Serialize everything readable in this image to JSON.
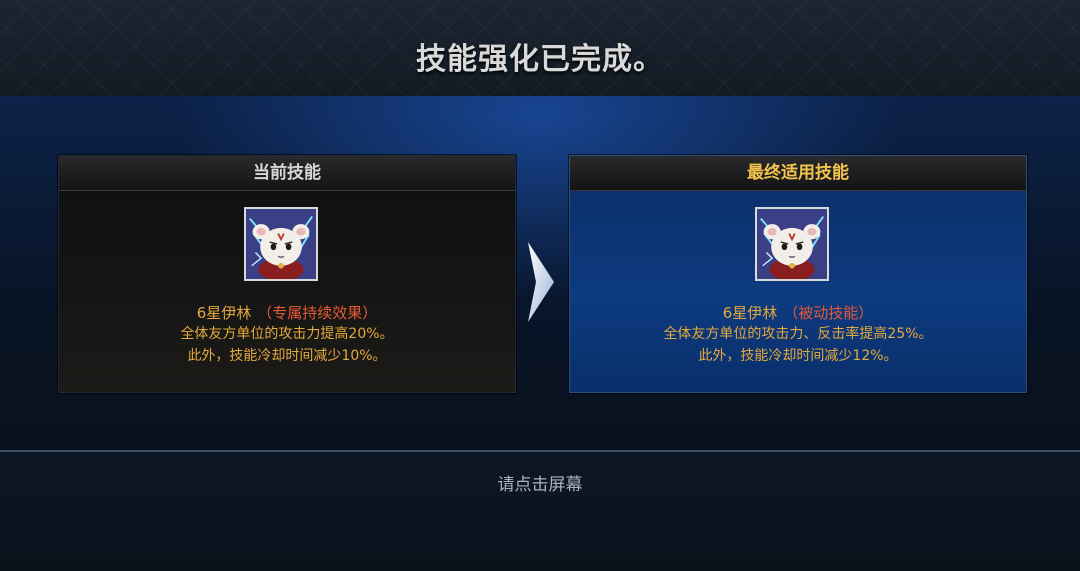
{
  "title": "技能强化已完成。",
  "current_panel": {
    "header": "当前技能",
    "skill_name": "6星伊林",
    "skill_tag": "（专属持续效果）",
    "desc_line1": "全体友方单位的攻击力提高20%。",
    "desc_line2": "此外，技能冷却时间减少10%。",
    "portrait_icon": "cat-hero-portrait-icon"
  },
  "final_panel": {
    "header": "最终适用技能",
    "skill_name": "6星伊林",
    "skill_tag": "（被动技能）",
    "desc_line1": "全体友方单位的攻击力、反击率提高25%。",
    "desc_line2": "此外，技能冷却时间减少12%。",
    "portrait_icon": "cat-hero-portrait-icon"
  },
  "arrow_icon": "chevron-right-icon",
  "hint": "请点击屏幕",
  "colors": {
    "skill_text": "#e4a93c",
    "tag_text": "#e65a36",
    "final_header": "#f2c44d"
  }
}
